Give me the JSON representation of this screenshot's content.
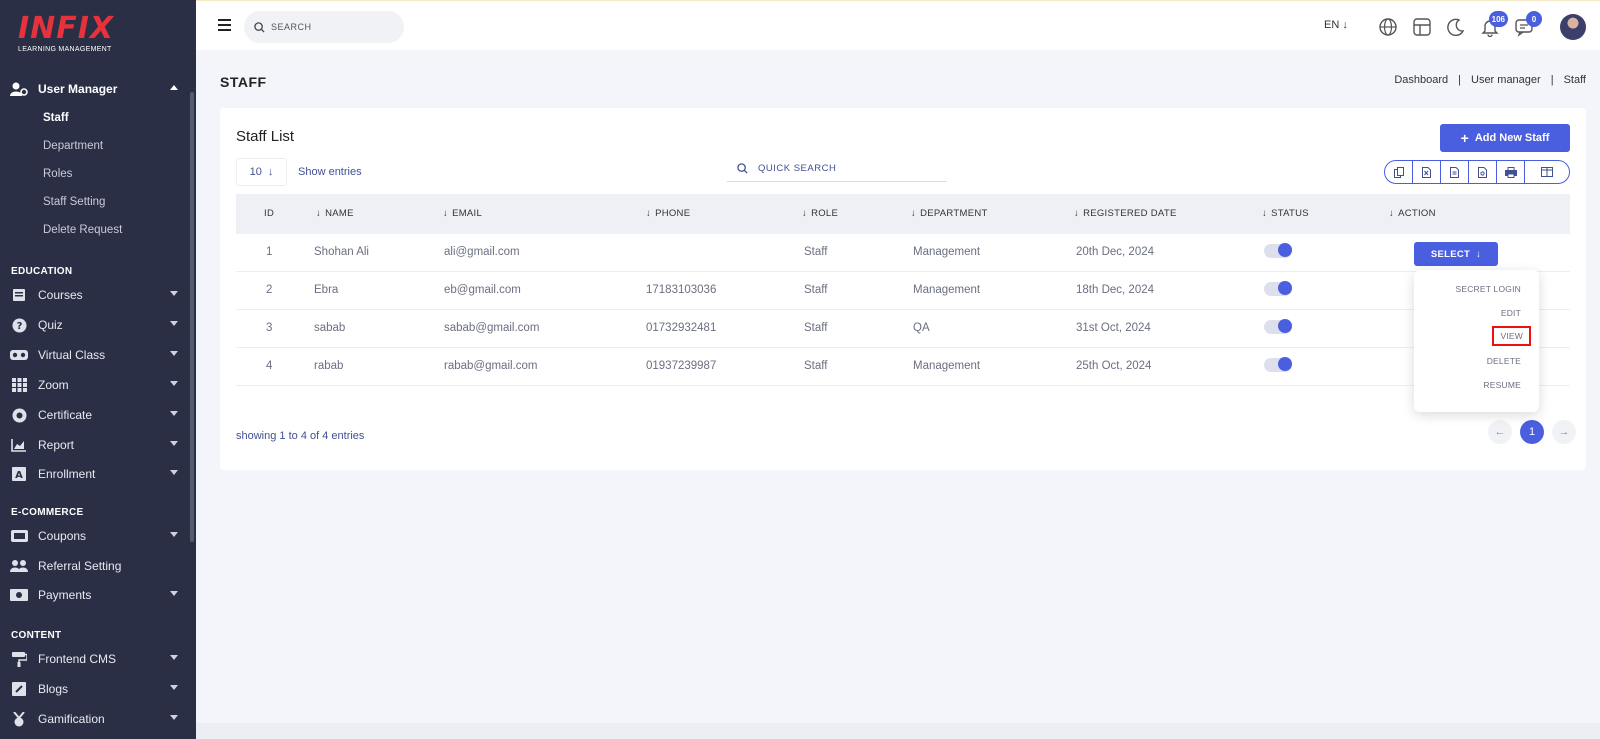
{
  "brand": {
    "logo_text": "INFIX",
    "tagline": "LEARNING MANAGEMENT"
  },
  "sidebar": {
    "user_manager": {
      "label": "User Manager",
      "items": [
        "Staff",
        "Department",
        "Roles",
        "Staff Setting",
        "Delete Request"
      ],
      "active": "Staff"
    },
    "sections": [
      {
        "title": "EDUCATION",
        "items": [
          "Courses",
          "Quiz",
          "Virtual Class",
          "Zoom",
          "Certificate",
          "Report",
          "Enrollment"
        ]
      },
      {
        "title": "E-COMMERCE",
        "items": [
          "Coupons",
          "Referral Setting",
          "Payments"
        ]
      },
      {
        "title": "CONTENT",
        "items": [
          "Frontend CMS",
          "Blogs",
          "Gamification"
        ]
      }
    ]
  },
  "header": {
    "search_placeholder": "SEARCH",
    "language": "EN",
    "notifications_count": "106",
    "messages_count": "0"
  },
  "page": {
    "title": "STAFF",
    "breadcrumb": [
      "Dashboard",
      "User manager",
      "Staff"
    ]
  },
  "card": {
    "title": "Staff List",
    "add_button": "Add New Staff",
    "entries_value": "10",
    "show_entries": "Show entries",
    "quick_search_placeholder": "QUICK SEARCH",
    "showing_text": "showing 1 to 4 of 4 entries",
    "current_page": "1"
  },
  "table": {
    "columns": [
      "ID",
      "NAME",
      "EMAIL",
      "PHONE",
      "ROLE",
      "DEPARTMENT",
      "REGISTERED DATE",
      "STATUS",
      "ACTION"
    ],
    "rows": [
      {
        "id": "1",
        "name": "Shohan Ali",
        "email": "ali@gmail.com",
        "phone": "",
        "role": "Staff",
        "department": "Management",
        "date": "20th Dec, 2024",
        "status": true
      },
      {
        "id": "2",
        "name": "Ebra",
        "email": "eb@gmail.com",
        "phone": "17183103036",
        "role": "Staff",
        "department": "Management",
        "date": "18th Dec, 2024",
        "status": true
      },
      {
        "id": "3",
        "name": "sabab",
        "email": "sabab@gmail.com",
        "phone": "01732932481",
        "role": "Staff",
        "department": "QA",
        "date": "31st Oct, 2024",
        "status": true
      },
      {
        "id": "4",
        "name": "rabab",
        "email": "rabab@gmail.com",
        "phone": "01937239987",
        "role": "Staff",
        "department": "Management",
        "date": "25th Oct, 2024",
        "status": true
      }
    ]
  },
  "action_menu": {
    "select_label": "SELECT",
    "items": [
      "SECRET LOGIN",
      "EDIT",
      "VIEW",
      "DELETE",
      "RESUME"
    ],
    "highlighted": "VIEW"
  },
  "colors": {
    "sidebar_bg": "#2a2f45",
    "accent": "#4a5fe0",
    "brand_red": "#e6323c",
    "highlight_border": "#e11111"
  }
}
